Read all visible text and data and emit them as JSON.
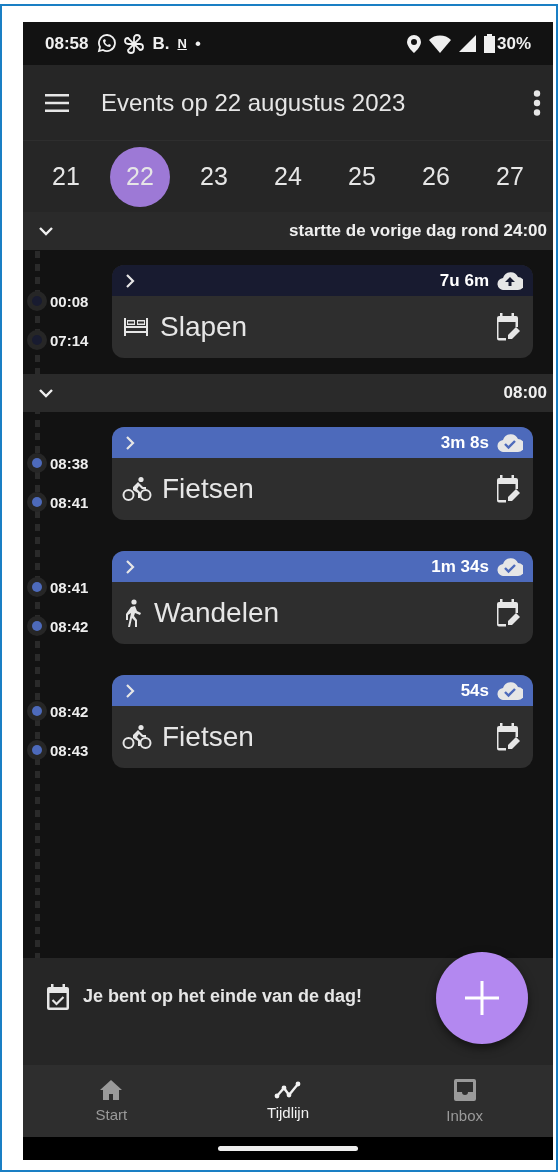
{
  "status_bar": {
    "time": "08:58",
    "notification_texts": [
      "B.",
      "N"
    ],
    "dot": "•",
    "battery": "30%"
  },
  "app_bar": {
    "title": "Events op 22 augustus 2023"
  },
  "days": [
    {
      "label": "21",
      "selected": false
    },
    {
      "label": "22",
      "selected": true
    },
    {
      "label": "23",
      "selected": false
    },
    {
      "label": "24",
      "selected": false
    },
    {
      "label": "25",
      "selected": false
    },
    {
      "label": "26",
      "selected": false
    },
    {
      "label": "27",
      "selected": false
    }
  ],
  "sections": [
    {
      "label": "startte de vorige dag rond 24:00",
      "expanded": true,
      "events": [
        {
          "kind": "sleep",
          "title": "Slapen",
          "duration": "7u 6m",
          "start": "00:08",
          "end": "07:14",
          "synced": false,
          "color": "#181b30"
        }
      ]
    },
    {
      "label": "08:00",
      "expanded": true,
      "events": [
        {
          "kind": "bike",
          "title": "Fietsen",
          "duration": "3m 8s",
          "start": "08:38",
          "end": "08:41",
          "synced": true,
          "color": "#4d6abb"
        },
        {
          "kind": "walk",
          "title": "Wandelen",
          "duration": "1m 34s",
          "start": "08:41",
          "end": "08:42",
          "synced": true,
          "color": "#4d6abb"
        },
        {
          "kind": "bike",
          "title": "Fietsen",
          "duration": "54s",
          "start": "08:42",
          "end": "08:43",
          "synced": true,
          "color": "#4d6abb"
        }
      ]
    }
  ],
  "footer": {
    "message": "Je bent op het einde van de dag!"
  },
  "nav": [
    {
      "kind": "home",
      "label": "Start",
      "selected": false
    },
    {
      "kind": "timeline",
      "label": "Tijdlijn",
      "selected": true
    },
    {
      "kind": "inbox",
      "label": "Inbox",
      "selected": false
    }
  ]
}
